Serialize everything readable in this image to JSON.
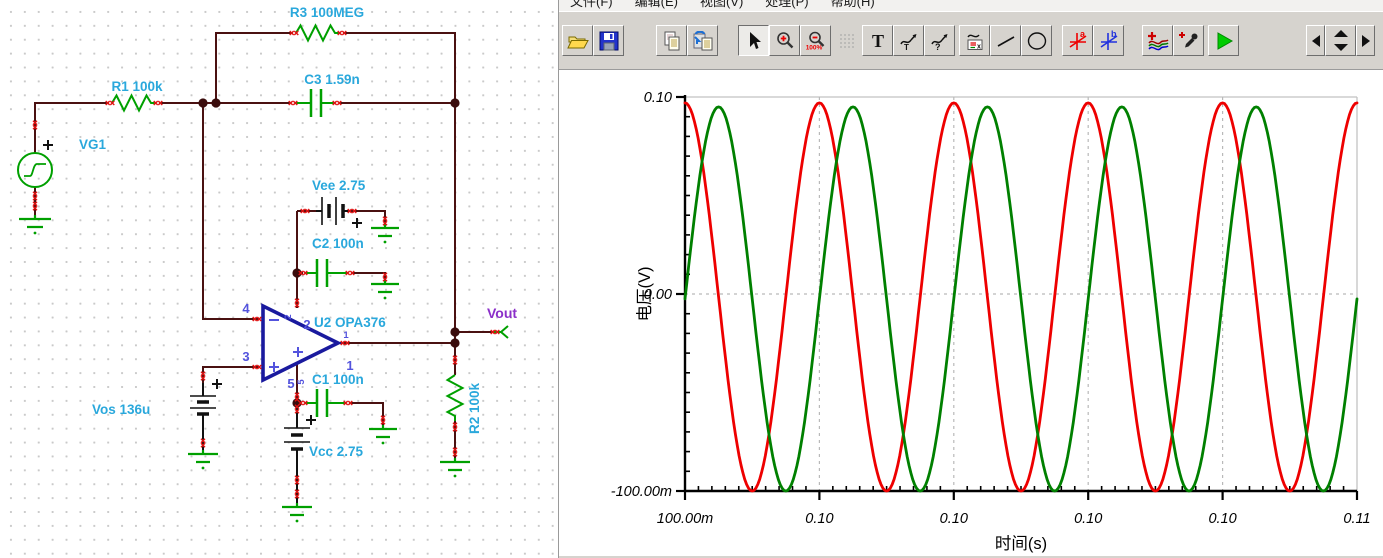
{
  "window": {
    "menu": [
      "文件(F)",
      "编辑(E)",
      "视图(V)",
      "处理(P)",
      "帮助(H)"
    ]
  },
  "toolbar": {
    "buttons": [
      "open",
      "save",
      "copy",
      "paste",
      "select-mode",
      "zoom-in",
      "zoom-100",
      "grid",
      "add-text",
      "annotate-curve-t",
      "annotate-curve-help",
      "legend",
      "draw-line",
      "draw-ellipse",
      "cursor-a",
      "cursor-b",
      "add-curves",
      "pick-curve",
      "run",
      "scroll-left",
      "value-spinner",
      "scroll-right"
    ],
    "zoom_100_label": "100%",
    "cursor_a_label": "a",
    "cursor_b_label": "b",
    "states": {
      "select-mode": "pressed",
      "grid": "disabled"
    }
  },
  "schematic": {
    "components": {
      "r1": "R1 100k",
      "r3": "R3 100MEG",
      "c3": "C3 1.59n",
      "vg1": "VG1",
      "vee": "Vee 2.75",
      "c2": "C2 100n",
      "u2": "U2 OPA376",
      "c1": "C1 100n",
      "vos": "Vos 136u",
      "vcc": "Vcc 2.75",
      "r2": "R2 100k",
      "vout": "Vout"
    },
    "pins": {
      "p1": "1",
      "p2": "2",
      "p3": "3",
      "p4": "4",
      "p5": "5"
    },
    "colors": {
      "wire": "#4a1111",
      "component": "#00a000",
      "label": "#2aa8dc",
      "pin": "#5353dd",
      "net_label": "#8b2fc9",
      "opamp": "#1a1a9e",
      "terminal_stub": "#e01010"
    }
  },
  "chart_data": {
    "type": "line",
    "title": "",
    "xlabel": "时间(s)",
    "ylabel": "电压(V)",
    "x_range_s": [
      0.1,
      0.11
    ],
    "y_range_v": [
      -0.1,
      0.1
    ],
    "x_tick_labels": [
      "100.00m",
      "0.10",
      "0.10",
      "0.10",
      "0.10",
      "0.11"
    ],
    "y_tick_labels": [
      "0.10",
      "0.00",
      "-100.00m"
    ],
    "x_minor_per_major": 10,
    "y_minor_per_major": 10,
    "grid": {
      "style": "dashed",
      "color": "#b9b9b9",
      "vertical_at_major_ticks": true,
      "horizontal_at": [
        "0.00",
        "0.10"
      ]
    },
    "legend": "none",
    "series": [
      {
        "id": "red-waveform",
        "color": "#ee0000",
        "waveform": "sine",
        "frequency_hz": 500,
        "amplitude_v": 0.0985,
        "offset_v": -0.0015,
        "phase_deg": 90
      },
      {
        "id": "green-waveform",
        "color": "#008000",
        "waveform": "sine",
        "frequency_hz": 500,
        "amplitude_v": 0.0975,
        "offset_v": -0.0025,
        "phase_deg": 0
      }
    ]
  }
}
